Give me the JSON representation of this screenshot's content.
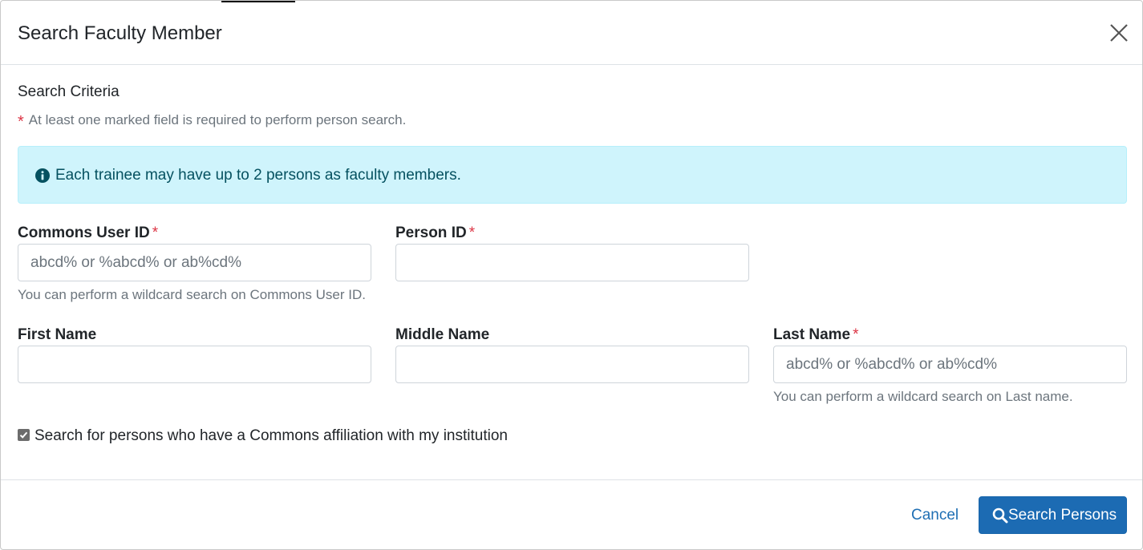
{
  "dialog": {
    "title": "Search Faculty Member",
    "close_icon": "close-icon"
  },
  "criteria": {
    "heading": "Search Criteria",
    "required_note": "At least one marked field is required to perform person search.",
    "required_marker": "*"
  },
  "alert": {
    "icon": "info-icon",
    "text": "Each trainee may have up to 2 persons as faculty members."
  },
  "fields": {
    "commons_user_id": {
      "label": "Commons User ID",
      "required": "*",
      "placeholder": "abcd% or %abcd% or ab%cd%",
      "value": "",
      "help": "You can perform a wildcard search on Commons User ID."
    },
    "person_id": {
      "label": "Person ID",
      "required": "*",
      "placeholder": "",
      "value": ""
    },
    "first_name": {
      "label": "First Name",
      "placeholder": "",
      "value": ""
    },
    "middle_name": {
      "label": "Middle Name",
      "placeholder": "",
      "value": ""
    },
    "last_name": {
      "label": "Last Name",
      "required": "*",
      "placeholder": "abcd% or %abcd% or ab%cd%",
      "value": "",
      "help": "You can perform a wildcard search on Last name."
    }
  },
  "affiliation": {
    "label": "Search for persons who have a Commons affiliation with my institution",
    "checked": true
  },
  "footer": {
    "cancel_label": "Cancel",
    "search_label": "Search Persons",
    "search_icon": "search-icon"
  },
  "colors": {
    "primary": "#1c6bb3",
    "link": "#1f6fb4",
    "required": "#dc3545",
    "alert_bg": "#cff4fc",
    "alert_text": "#055160"
  }
}
